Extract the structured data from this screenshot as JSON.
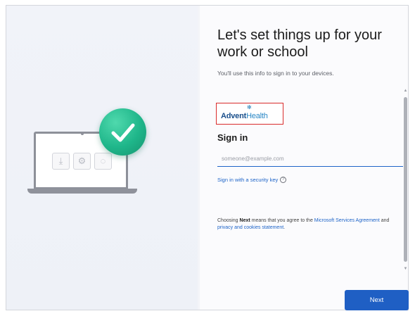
{
  "header": {
    "title": "Let's set things up for your work or school",
    "subtitle": "You'll use this info to sign in to your devices."
  },
  "logo": {
    "text_bold": "Advent",
    "text_light": "Health",
    "mark": "✻"
  },
  "signin": {
    "heading": "Sign in",
    "email_placeholder": "someone@example.com",
    "email_value": "",
    "security_key_link": "Sign in with a security key"
  },
  "legal": {
    "prefix": "Choosing ",
    "next_word": "Next",
    "middle": " means that you agree to the ",
    "agreement_link": "Microsoft Services Agreement",
    "and": " and ",
    "privacy_link": "privacy and cookies statement",
    "suffix": "."
  },
  "illustration": {
    "tiles": [
      "⤓",
      "⚙",
      "◌"
    ],
    "check_icon": "checkmark-icon",
    "check_color": "#1fb68a"
  },
  "footer": {
    "next_label": "Next"
  },
  "colors": {
    "accent": "#1f5fc4",
    "link": "#1e64c8",
    "logo_border": "#d92b2b"
  }
}
